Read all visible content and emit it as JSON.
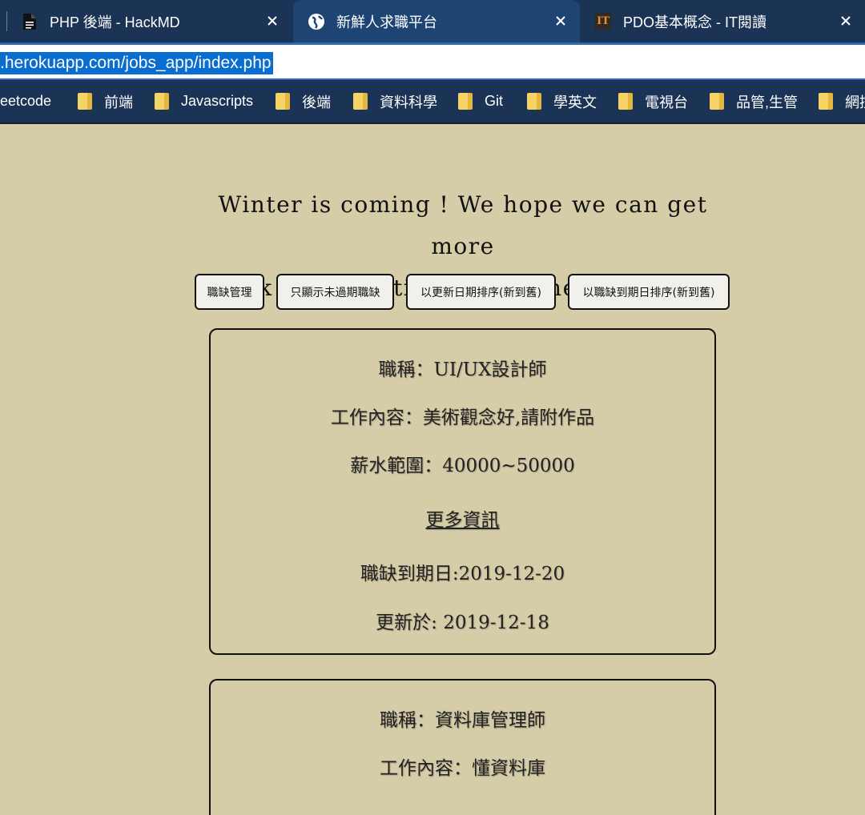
{
  "browser": {
    "tabs": [
      {
        "title": "PHP 後端 - HackMD",
        "icon": "document-icon"
      },
      {
        "title": "新鮮人求職平台",
        "icon": "globe-icon"
      },
      {
        "title": "PDO基本概念 - IT閱讀",
        "icon": "it-logo-icon",
        "icon_text": "IT"
      }
    ],
    "url": ".herokuapp.com/jobs_app/index.php",
    "bookmarks": [
      "eetcode",
      "前端",
      "Javascripts",
      "後端",
      "資料科學",
      "Git",
      "學英文",
      "電視台",
      "品管,生管",
      "網控"
    ],
    "colors": {
      "tabbar": "#1b3354",
      "active_tab": "#1e4474",
      "url_highlight": "#0a6ed1",
      "folder": "#f6d365"
    }
  },
  "page": {
    "background": "#d5cca8",
    "headline_line1": "Winter is coming ! We hope we can get more",
    "headline_line2": "work opporunities !! Give me a chance !",
    "buttons": [
      "職缺管理",
      "只顯示未過期職缺",
      "以更新日期排序(新到舊)",
      "以職缺到期日排序(新到舊)"
    ],
    "jobs": [
      {
        "title": "職稱：UI/UX設計師",
        "description": "工作內容：美術觀念好,請附作品",
        "salary": "薪水範圍：40000~50000",
        "more_link": "更多資訊",
        "expiry": "職缺到期日:2019-12-20",
        "updated": "更新於: 2019-12-18"
      },
      {
        "title": "職稱：資料庫管理師",
        "description": "工作內容：懂資料庫"
      }
    ]
  }
}
